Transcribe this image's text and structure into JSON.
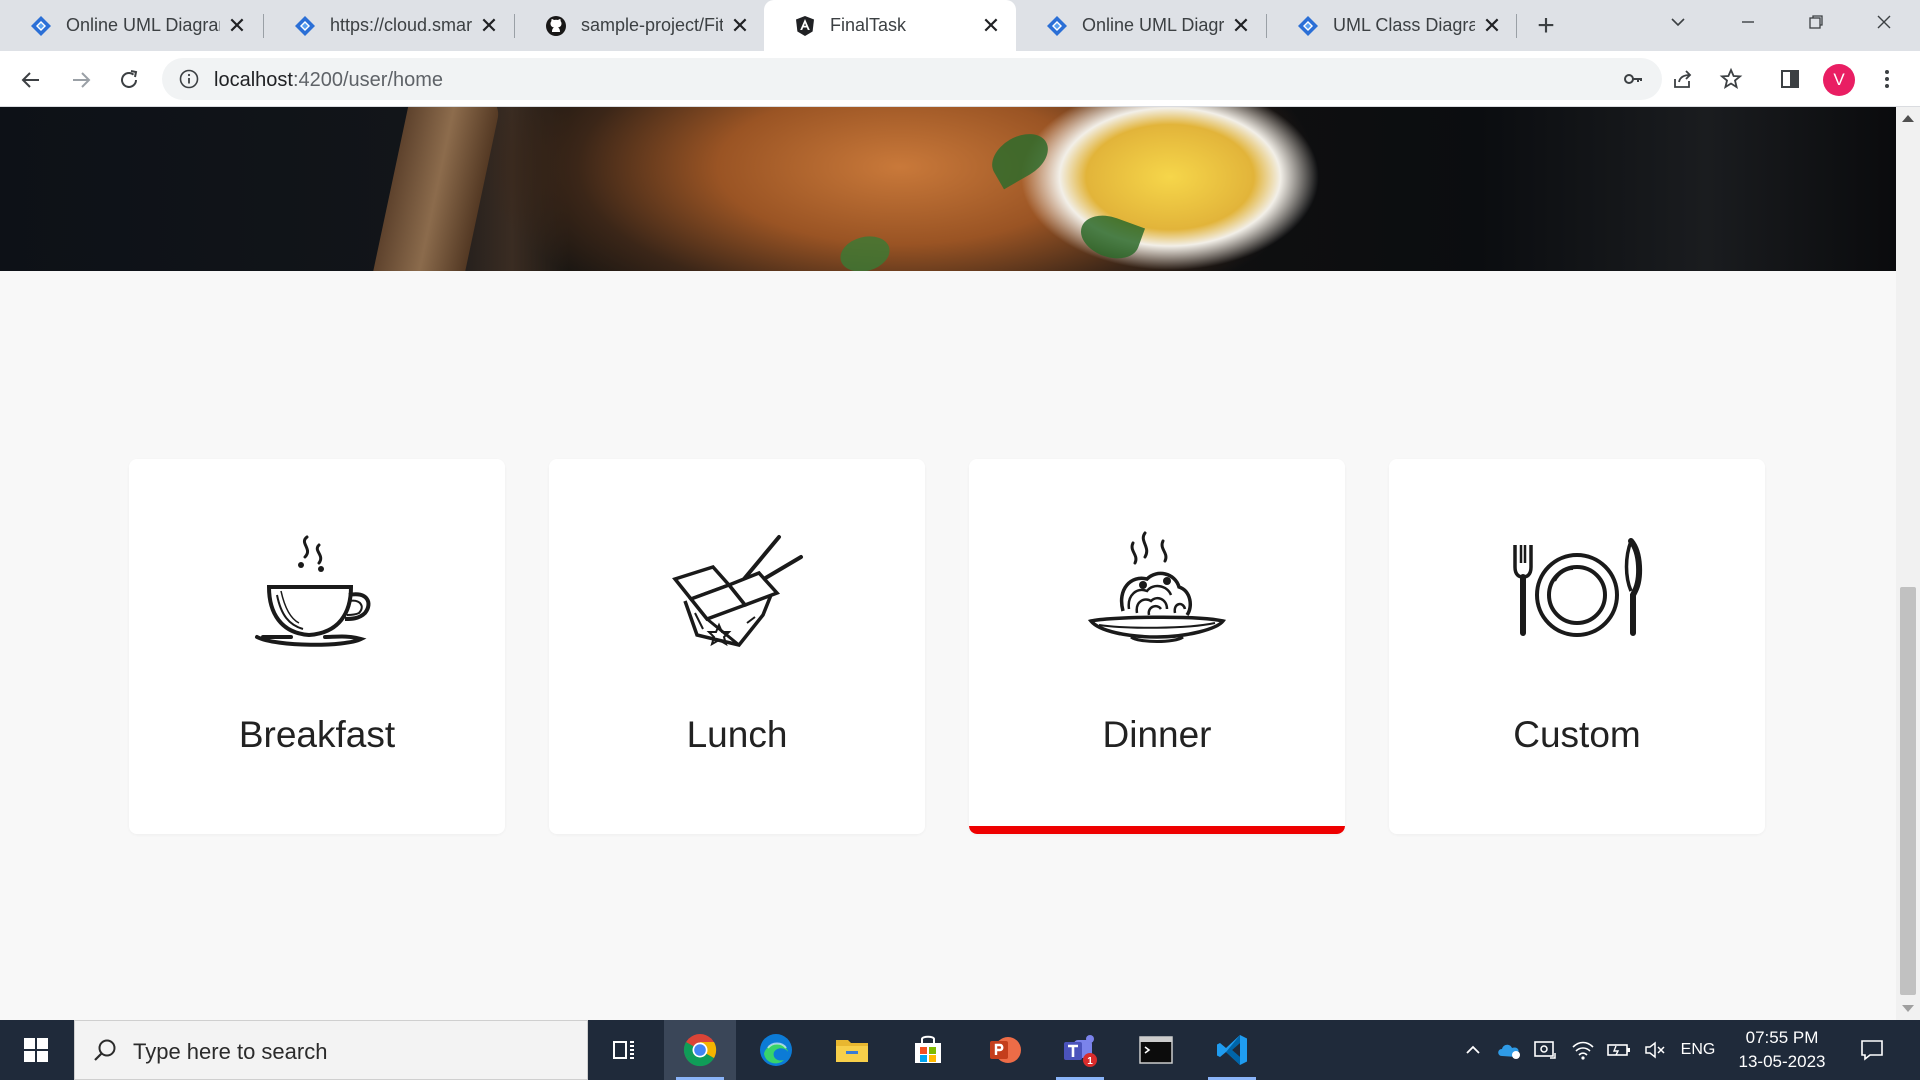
{
  "browser": {
    "tabs": [
      {
        "title": "Online UML Diagrams",
        "favicon": "smartdraw-icon",
        "active": false
      },
      {
        "title": "https://cloud.smartdraw.com",
        "favicon": "smartdraw-icon",
        "active": false
      },
      {
        "title": "sample-project/FitF",
        "favicon": "github-icon",
        "active": false
      },
      {
        "title": "FinalTask",
        "favicon": "angular-icon",
        "active": true
      },
      {
        "title": "Online UML Diagrams",
        "favicon": "smartdraw-icon",
        "active": false
      },
      {
        "title": "UML Class Diagrams",
        "favicon": "smartdraw-icon",
        "active": false
      }
    ],
    "url_host": "localhost",
    "url_path": ":4200/user/home",
    "profile_initial": "V"
  },
  "meal_cards": [
    {
      "label": "Breakfast",
      "icon": "coffee-cup-icon",
      "selected": false
    },
    {
      "label": "Lunch",
      "icon": "takeout-box-icon",
      "selected": false
    },
    {
      "label": "Dinner",
      "icon": "pasta-plate-icon",
      "selected": true
    },
    {
      "label": "Custom",
      "icon": "plate-cutlery-icon",
      "selected": false
    }
  ],
  "colors": {
    "selected_bar": "#ee0000",
    "page_background": "#f8f8f8",
    "taskbar": "#1f2a3a"
  },
  "taskbar": {
    "search_placeholder": "Type here to search",
    "apps": [
      "task-view-icon",
      "chrome-icon",
      "edge-icon",
      "file-explorer-icon",
      "microsoft-store-icon",
      "powerpoint-icon",
      "teams-icon",
      "terminal-icon",
      "vscode-icon"
    ],
    "teams_badge": "1",
    "language": "ENG",
    "time": "07:55 PM",
    "date": "13-05-2023"
  }
}
